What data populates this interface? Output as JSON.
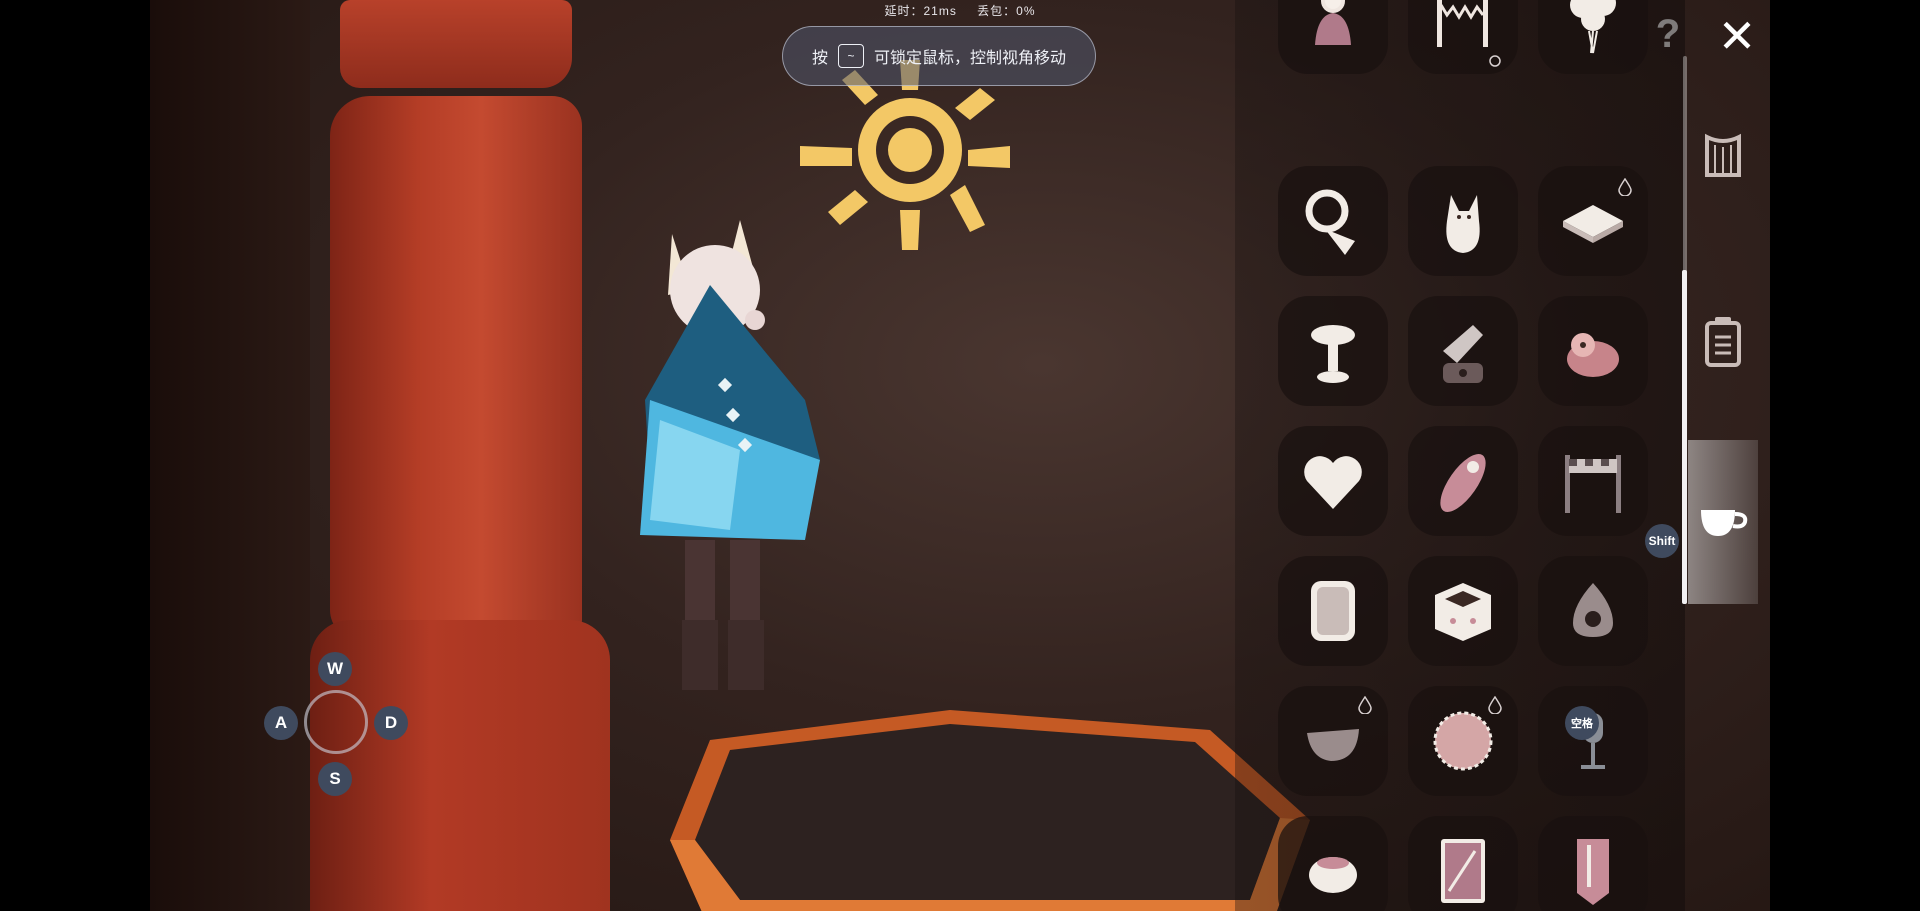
{
  "hud": {
    "latency_label": "延时：21ms",
    "packet_loss_label": "丢包：0%",
    "hint_prefix": "按",
    "hint_key": "~",
    "hint_text": "可锁定鼠标，控制视角移动"
  },
  "buttons": {
    "help_label": "?",
    "close_label": "✕"
  },
  "panel": {
    "items": [
      {
        "icon": "doll-icon",
        "drop": false
      },
      {
        "icon": "bunting-icon",
        "drop": false
      },
      {
        "icon": "balloons-icon",
        "drop": false
      },
      {
        "icon": "tuba-icon",
        "drop": false
      },
      {
        "icon": "fox-icon",
        "drop": false
      },
      {
        "icon": "cushion-icon",
        "drop": true
      },
      {
        "icon": "birdbath-icon",
        "drop": false
      },
      {
        "icon": "telescope-icon",
        "drop": false
      },
      {
        "icon": "plush-bear-icon",
        "drop": false
      },
      {
        "icon": "heart-icon",
        "drop": false
      },
      {
        "icon": "surfboard-icon",
        "drop": false
      },
      {
        "icon": "finish-banner-icon",
        "drop": false
      },
      {
        "icon": "mirror-icon",
        "drop": false
      },
      {
        "icon": "box-icon",
        "drop": false
      },
      {
        "icon": "campfire-icon",
        "drop": false
      },
      {
        "icon": "bowl-icon",
        "drop": true
      },
      {
        "icon": "round-rug-icon",
        "drop": true
      },
      {
        "icon": "microphone-icon",
        "drop": false
      },
      {
        "icon": "pot-icon",
        "drop": false
      },
      {
        "icon": "card-icon",
        "drop": false
      },
      {
        "icon": "scroll-icon",
        "drop": false
      }
    ],
    "side_tabs": [
      "harp-icon",
      "journal-icon",
      "teacup-icon"
    ],
    "shift_label": "Shift",
    "space_label": "空格"
  },
  "movement": {
    "up": "W",
    "left": "A",
    "right": "D",
    "down": "S"
  }
}
